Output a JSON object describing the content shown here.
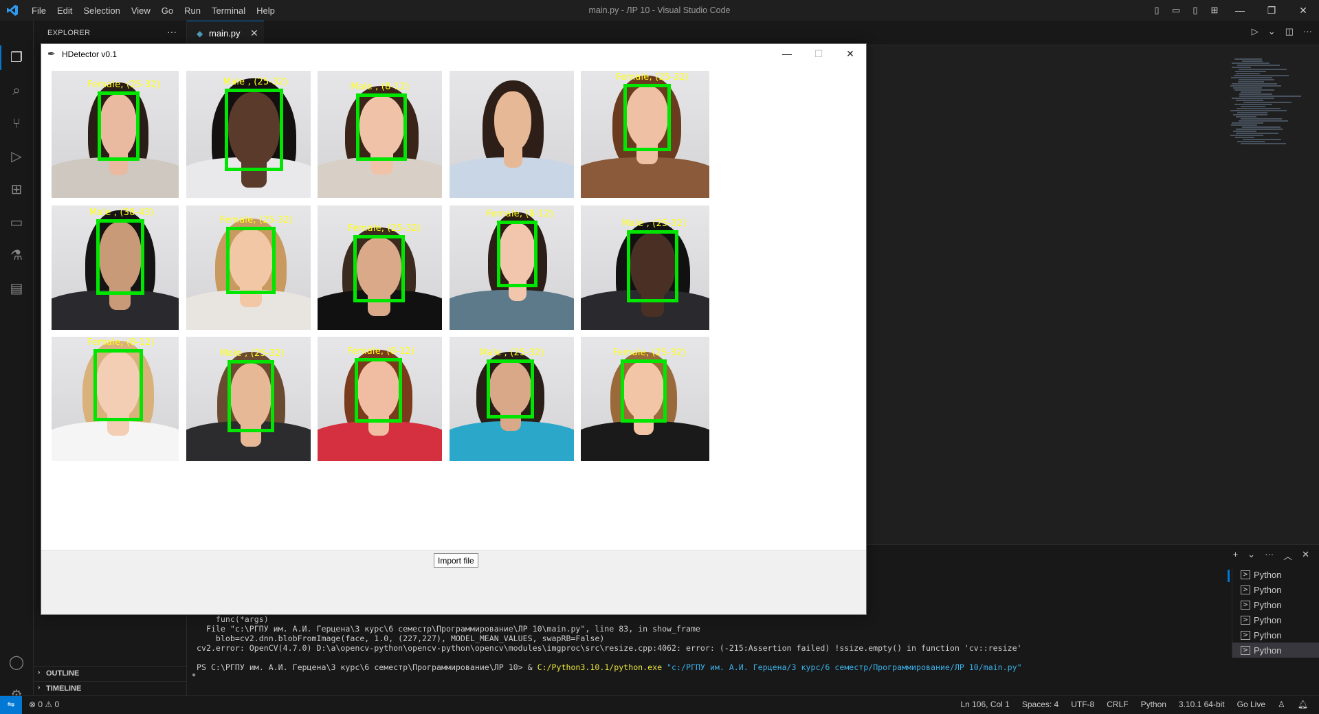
{
  "vscode": {
    "title": "main.py - ЛР 10 - Visual Studio Code",
    "menu": [
      "File",
      "Edit",
      "Selection",
      "View",
      "Go",
      "Run",
      "Terminal",
      "Help"
    ],
    "sidebar": {
      "header": "EXPLORER",
      "outline": "OUTLINE",
      "timeline": "TIMELINE"
    },
    "tab": {
      "name": "main.py"
    },
    "terminal": {
      "lines": [
        "    func(*args)",
        "  File \"c:\\РГПУ им. А.И. Герцена\\3 курс\\6 семестр\\Программирование\\ЛР 10\\main.py\", line 83, in show_frame",
        "    blob=cv2.dnn.blobFromImage(face, 1.0, (227,227), MODEL_MEAN_VALUES, swapRB=False)",
        "cv2.error: OpenCV(4.7.0) D:\\a\\opencv-python\\opencv-python\\opencv\\modules\\imgproc\\src\\resize.cpp:4062: error: (-215:Assertion failed) !ssize.empty() in function 'cv::resize'"
      ],
      "prompt": "PS C:\\РГПУ им. А.И. Герцена\\3 курс\\6 семестр\\Программирование\\ЛР 10> & ",
      "exe": "C:/Python3.10.1/python.exe",
      "arg": " \"c:/РГПУ им. А.И. Герцена/3 курс/6 семестр/Программирование/ЛР 10/main.py\"",
      "sessions": [
        "Python",
        "Python",
        "Python",
        "Python",
        "Python",
        "Python"
      ]
    },
    "status": {
      "problems": "⊗ 0 ⚠ 0",
      "position": "Ln 106, Col 1",
      "spaces": "Spaces: 4",
      "encoding": "UTF-8",
      "eol": "CRLF",
      "language": "Python",
      "interpreter": "3.10.1 64-bit",
      "golive": "Go Live"
    }
  },
  "app": {
    "title": "HDetector v0.1",
    "import_button": "Import file",
    "labels": [
      "Female, (25-32)",
      "Male , (25-32)",
      "Male , (8-12)",
      "",
      "Female, (25-32)",
      "Male , (38-43)",
      "Female, (25-32)",
      "Female, (25-32)",
      "Female, (8-12)",
      "Male , (25-32)",
      "Female, (8-12)",
      "Male , (25-32)",
      "Female, (8-12)",
      "Male , (25-32)",
      "Female, (25-32)"
    ],
    "colors": {
      "box": "#00e600",
      "label": "#ffff1a"
    }
  }
}
